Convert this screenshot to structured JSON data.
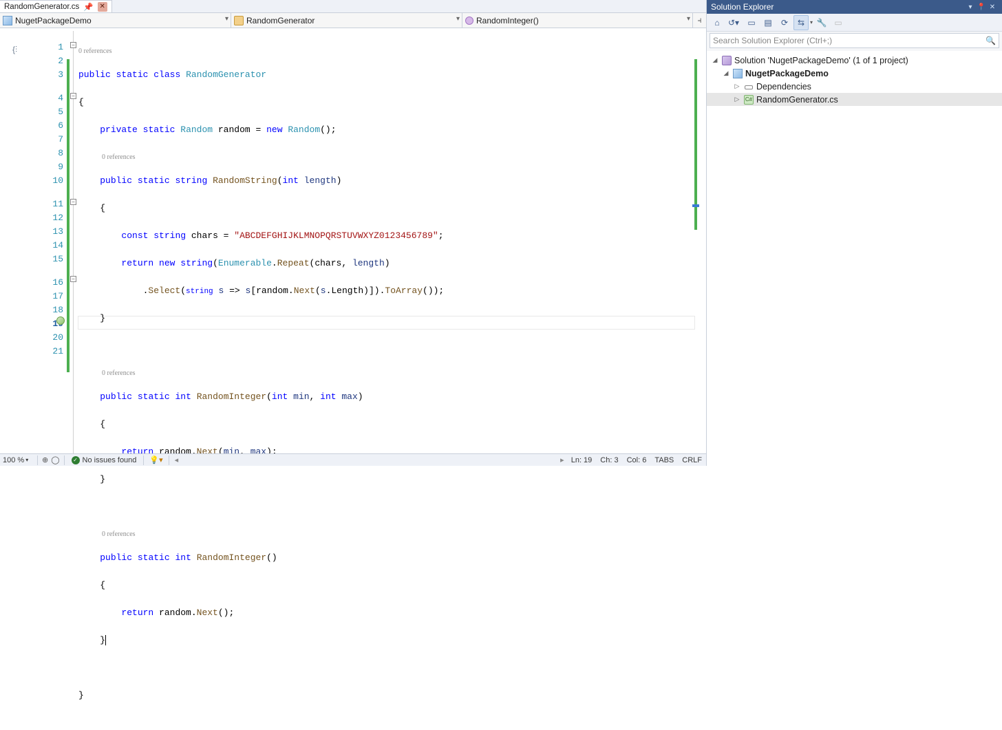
{
  "tab": {
    "filename": "RandomGenerator.cs",
    "pinned": true
  },
  "navbar": {
    "project": "NugetPackageDemo",
    "class": "RandomGenerator",
    "member": "RandomInteger()"
  },
  "references_label": "0 references",
  "code": {
    "lines": [
      1,
      2,
      3,
      4,
      5,
      6,
      7,
      8,
      9,
      10,
      11,
      12,
      13,
      14,
      15,
      16,
      17,
      18,
      19,
      20,
      21
    ],
    "string_literal": "\"ABCDEFGHIJKLMNOPQRSTUVWXYZ0123456789\""
  },
  "status": {
    "zoom": "100 %",
    "issues": "No issues found",
    "line": "Ln: 19",
    "char": "Ch: 3",
    "col": "Col: 6",
    "tabs": "TABS",
    "encoding": "CRLF"
  },
  "solution_explorer": {
    "title": "Solution Explorer",
    "search_placeholder": "Search Solution Explorer (Ctrl+;)",
    "solution_label": "Solution 'NugetPackageDemo' (1 of 1 project)",
    "project": "NugetPackageDemo",
    "dependencies": "Dependencies",
    "file": "RandomGenerator.cs"
  }
}
